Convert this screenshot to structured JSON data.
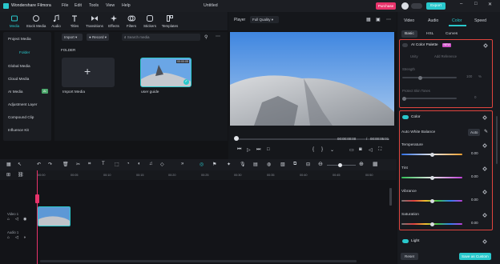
{
  "app": {
    "name": "Wondershare Filmora",
    "menus": [
      "File",
      "Edit",
      "Tools",
      "View",
      "Help"
    ],
    "document_title": "Untitled",
    "purchase_label": "Purchase",
    "export_label": "Export"
  },
  "media_toolbar": {
    "items": [
      "Media",
      "Stock Media",
      "Audio",
      "Titles",
      "Transitions",
      "Effects",
      "Filters",
      "Stickers",
      "Templates"
    ],
    "active": "Media"
  },
  "sidebar": {
    "items": [
      "Project Media",
      "Folder",
      "Global Media",
      "Cloud Media",
      "AI Media",
      "Adjustment Layer",
      "Compound Clip",
      "Influence Kit"
    ],
    "selected": "Folder",
    "ai_badge": "AI"
  },
  "media_bin": {
    "import_label": "Import",
    "record_label": "Record",
    "search_placeholder": "Search media",
    "folder_heading": "FOLDER",
    "import_tile_label": "Import Media",
    "clip_label": "user guide",
    "clip_duration": "00:00:05"
  },
  "player": {
    "label": "Player",
    "quality": "Full Quality",
    "current_time": "00:00:00:00",
    "separator": "/",
    "total_time": "00:00:05:01"
  },
  "inspector": {
    "tabs": [
      "Video",
      "Audio",
      "Color",
      "Speed"
    ],
    "active_tab": "Color",
    "subtabs": [
      "Basic",
      "HSL",
      "Curves"
    ],
    "active_subtab": "Basic",
    "ai_palette": {
      "title": "AI Color Palette",
      "badge": "NEW",
      "opt1": "Unity",
      "opt2": "Add Reference",
      "strength_label": "Strength",
      "strength_value": "100",
      "strength_unit": "%",
      "protect_label": "Protect Skin Tones",
      "protect_value": "0"
    },
    "color": {
      "title": "Color",
      "awb_label": "Auto White Balance",
      "auto_label": "Auto",
      "sliders": [
        {
          "label": "Temperature",
          "value": "0.00",
          "level": 0.5
        },
        {
          "label": "Tint",
          "value": "0.00",
          "level": 0.5
        },
        {
          "label": "Vibrance",
          "value": "0.00",
          "level": 0.5
        },
        {
          "label": "Saturation",
          "value": "0.00",
          "level": 0.5
        }
      ]
    },
    "light_label": "Light",
    "reset_label": "Reset",
    "save_custom_label": "Save as Custom"
  },
  "timeline": {
    "ticks": [
      "00:00",
      "00:05",
      "00:10",
      "00:15",
      "00:20",
      "00:25",
      "00:30",
      "00:35",
      "00:40",
      "00:45",
      "00:50"
    ],
    "track_video": "Video 1",
    "track_audio": "Audio 1"
  },
  "colors": {
    "accent": "#29c8cc",
    "purchase": "#e8336b",
    "highlight": "#e0443e",
    "playhead": "#e8336b"
  }
}
